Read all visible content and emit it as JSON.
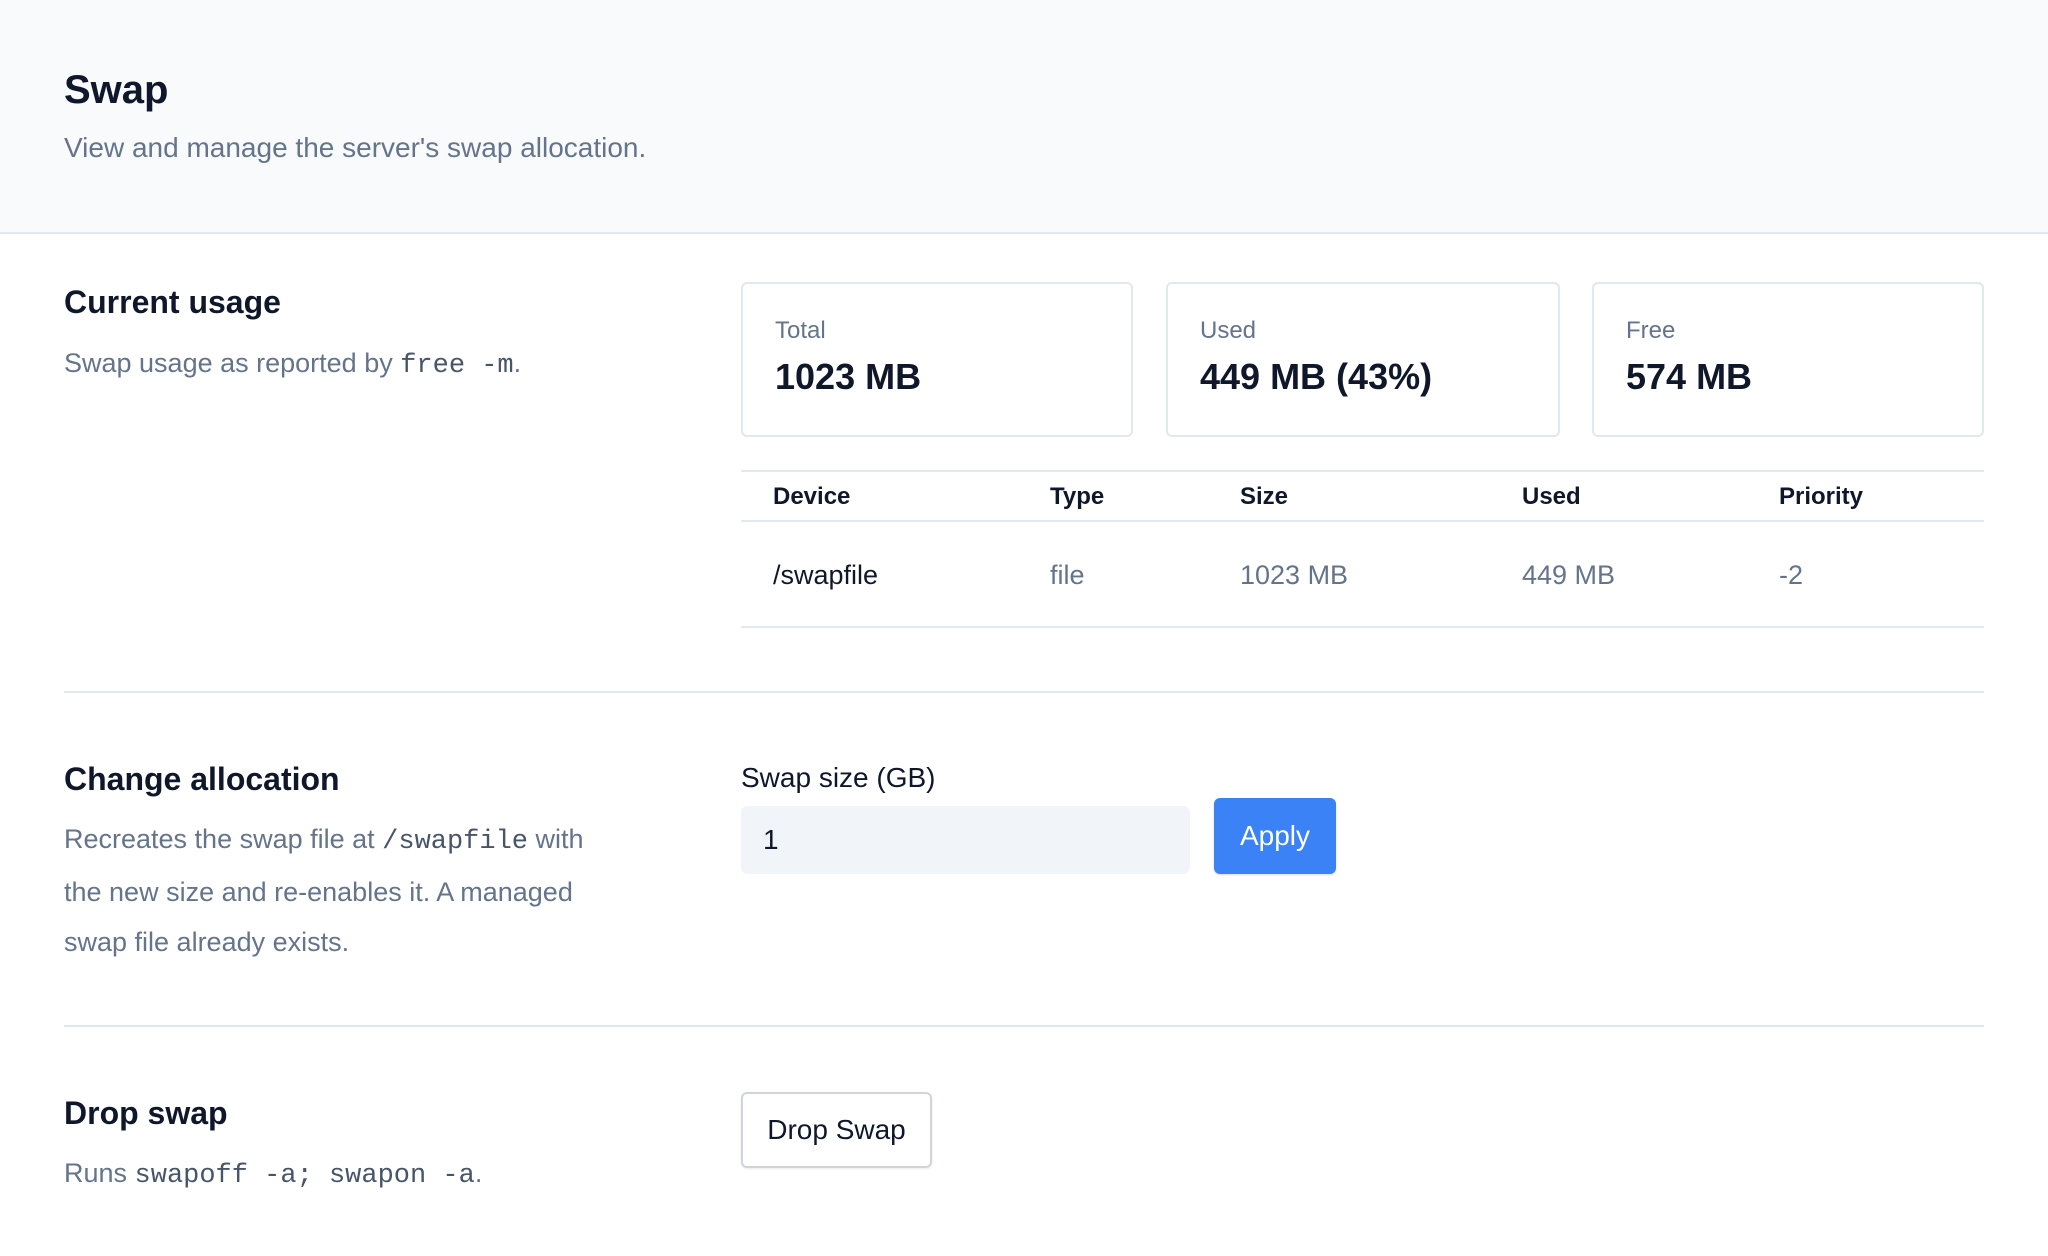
{
  "header": {
    "title": "Swap",
    "subtitle": "View and manage the server's swap allocation."
  },
  "current_usage": {
    "title": "Current usage",
    "desc_prefix": "Swap usage as reported by ",
    "desc_code": "free -m",
    "desc_suffix": ".",
    "stats": [
      {
        "label": "Total",
        "value": "1023 MB"
      },
      {
        "label": "Used",
        "value": "449 MB (43%)"
      },
      {
        "label": "Free",
        "value": "574 MB"
      }
    ],
    "table": {
      "headers": [
        "Device",
        "Type",
        "Size",
        "Used",
        "Priority"
      ],
      "rows": [
        [
          "/swapfile",
          "file",
          "1023 MB",
          "449 MB",
          "-2"
        ]
      ]
    }
  },
  "change_allocation": {
    "title": "Change allocation",
    "desc_prefix": "Recreates the swap file at ",
    "desc_code": "/swapfile",
    "desc_suffix": " with the new size and re-enables it. A managed swap file already exists.",
    "field_label": "Swap size (GB)",
    "field_value": "1",
    "apply_label": "Apply"
  },
  "drop_swap": {
    "title": "Drop swap",
    "desc_prefix": "Runs ",
    "desc_code": "swapoff -a; swapon -a",
    "desc_suffix": ".",
    "button_label": "Drop Swap"
  },
  "colors": {
    "accent": "#3b82f6",
    "header_bg": "#f8fafc",
    "border": "#e2e8f0",
    "muted_text": "#64748b"
  }
}
